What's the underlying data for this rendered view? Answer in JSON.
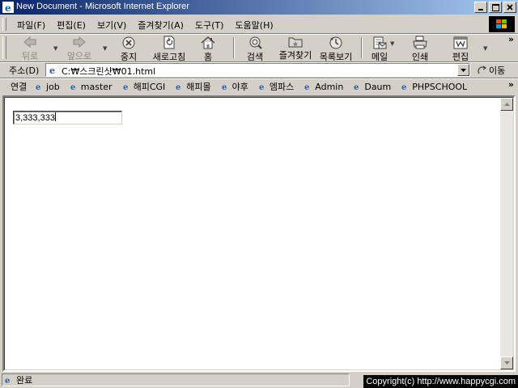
{
  "window": {
    "title": "New Document - Microsoft Internet Explorer"
  },
  "menu": [
    "파일(F)",
    "편집(E)",
    "보기(V)",
    "즐겨찾기(A)",
    "도구(T)",
    "도움말(H)"
  ],
  "toolbar": {
    "back": "뒤로",
    "forward": "앞으로",
    "stop": "중지",
    "refresh": "새로고침",
    "home": "홈",
    "search": "검색",
    "favorites": "즐겨찾기",
    "history": "목록보기",
    "mail": "메일",
    "print": "인쇄",
    "edit": "편집"
  },
  "address": {
    "label": "주소(D)",
    "url": "C:₩스크린샷₩01.html",
    "go": "이동"
  },
  "links": {
    "label": "연결",
    "items": [
      "job",
      "master",
      "해피CGI",
      "해피몰",
      "야후",
      "엠파스",
      "Admin",
      "Daum",
      "PHPSCHOOL"
    ]
  },
  "page": {
    "input_value": "3,333,333"
  },
  "status": {
    "text": "완료",
    "overlay": "Copyright(c) http://www.happycgi.com"
  }
}
